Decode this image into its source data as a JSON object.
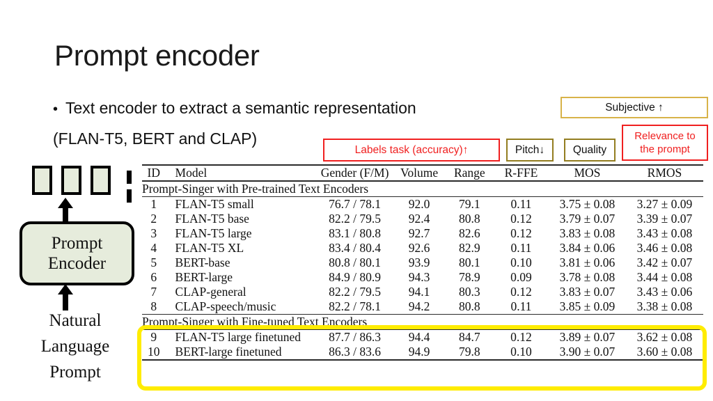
{
  "slide": {
    "title": "Prompt encoder",
    "bullets": [
      "Text encoder to extract a semantic representation",
      "(FLAN-T5, BERT and CLAP)"
    ],
    "bullet_marker": "•"
  },
  "callouts": [
    {
      "id": "subjective",
      "label": "Subjective ↑",
      "border_color": "#d8b349",
      "text_color": "#111111"
    },
    {
      "id": "labels_task",
      "label": "Labels task (accuracy)↑",
      "border_color": "#f02020",
      "text_color": "#f02020"
    },
    {
      "id": "pitch",
      "label": "Pitch↓",
      "border_color": "#937d20",
      "text_color": "#111111"
    },
    {
      "id": "quality",
      "label": "Quality",
      "border_color": "#937d20",
      "text_color": "#111111"
    },
    {
      "id": "relevance",
      "label_line1": "Relevance to",
      "label_line2": "the prompt",
      "border_color": "#f02020",
      "text_color": "#f02020"
    }
  ],
  "diagram": {
    "encoder_line1": "Prompt",
    "encoder_line2": "Encoder",
    "caption_line1": "Natural",
    "caption_line2": "Language",
    "caption_line3": "Prompt",
    "token_count": 3,
    "token_fill": "#e6ecdc",
    "box_fill": "#e6ecdc"
  },
  "table": {
    "columns": [
      "ID",
      "Model",
      "Gender (F/M)",
      "Volume",
      "Range",
      "R-FFE",
      "MOS",
      "RMOS"
    ],
    "section_pretrained": "Prompt-Singer with Pre-trained Text Encoders",
    "section_finetuned": "Prompt-Singer with Fine-tuned Text Encoders",
    "highlight_color": "#ffec00",
    "rows_pretrained": [
      {
        "id": "1",
        "model": "FLAN-T5 small",
        "gender": "76.7 / 78.1",
        "volume": "92.0",
        "range": "79.1",
        "rffe": "0.11",
        "mos": "3.75 ± 0.08",
        "rmos": "3.27 ± 0.09",
        "bold": []
      },
      {
        "id": "2",
        "model": "FLAN-T5 base",
        "gender": "82.2 / 79.5",
        "volume": "92.4",
        "range": "80.8",
        "rffe": "0.12",
        "mos": "3.79 ± 0.07",
        "rmos": "3.39 ± 0.07",
        "bold": []
      },
      {
        "id": "3",
        "model": "FLAN-T5 large",
        "gender": "83.1 / 80.8",
        "volume": "92.7",
        "range": "82.6",
        "rffe": "0.12",
        "mos": "3.83 ± 0.08",
        "rmos": "3.43 ± 0.08",
        "bold": []
      },
      {
        "id": "4",
        "model": "FLAN-T5 XL",
        "gender": "83.4 / 80.4",
        "volume": "92.6",
        "range": "82.9",
        "rffe": "0.11",
        "mos": "3.84 ± 0.06",
        "rmos": "3.46 ± 0.08",
        "bold": []
      },
      {
        "id": "5",
        "model": "BERT-base",
        "gender": "80.8 / 80.1",
        "volume": "93.9",
        "range": "80.1",
        "rffe": "0.10",
        "mos": "3.81 ± 0.06",
        "rmos": "3.42 ± 0.07",
        "bold": []
      },
      {
        "id": "6",
        "model": "BERT-large",
        "gender": "84.9 / 80.9",
        "volume": "94.3",
        "range": "78.9",
        "rffe": "0.09",
        "mos": "3.78 ± 0.08",
        "rmos": "3.44 ± 0.08",
        "bold": [
          "rffe"
        ]
      },
      {
        "id": "7",
        "model": "CLAP-general",
        "gender": "82.2 / 79.5",
        "volume": "94.1",
        "range": "80.3",
        "rffe": "0.12",
        "mos": "3.83 ± 0.07",
        "rmos": "3.43 ± 0.06",
        "bold": []
      },
      {
        "id": "8",
        "model": "CLAP-speech/music",
        "gender": "82.2 / 78.1",
        "volume": "94.2",
        "range": "80.8",
        "rffe": "0.11",
        "mos": "3.85 ± 0.09",
        "rmos": "3.38 ± 0.08",
        "bold": []
      }
    ],
    "rows_finetuned": [
      {
        "id": "9",
        "model": "FLAN-T5 large finetuned",
        "gender": "87.7 / 86.3",
        "volume": "94.4",
        "range": "84.7",
        "rffe": "0.12",
        "mos": "3.89 ± 0.07",
        "rmos": "3.62 ± 0.08",
        "bold": [
          "gender",
          "range",
          "rmos"
        ]
      },
      {
        "id": "10",
        "model": "BERT-large finetuned",
        "gender": "86.3 / 83.6",
        "volume": "94.9",
        "range": "79.8",
        "rffe": "0.10",
        "mos": "3.90 ± 0.07",
        "rmos": "3.60 ± 0.08",
        "bold": [
          "volume",
          "mos"
        ]
      }
    ]
  }
}
